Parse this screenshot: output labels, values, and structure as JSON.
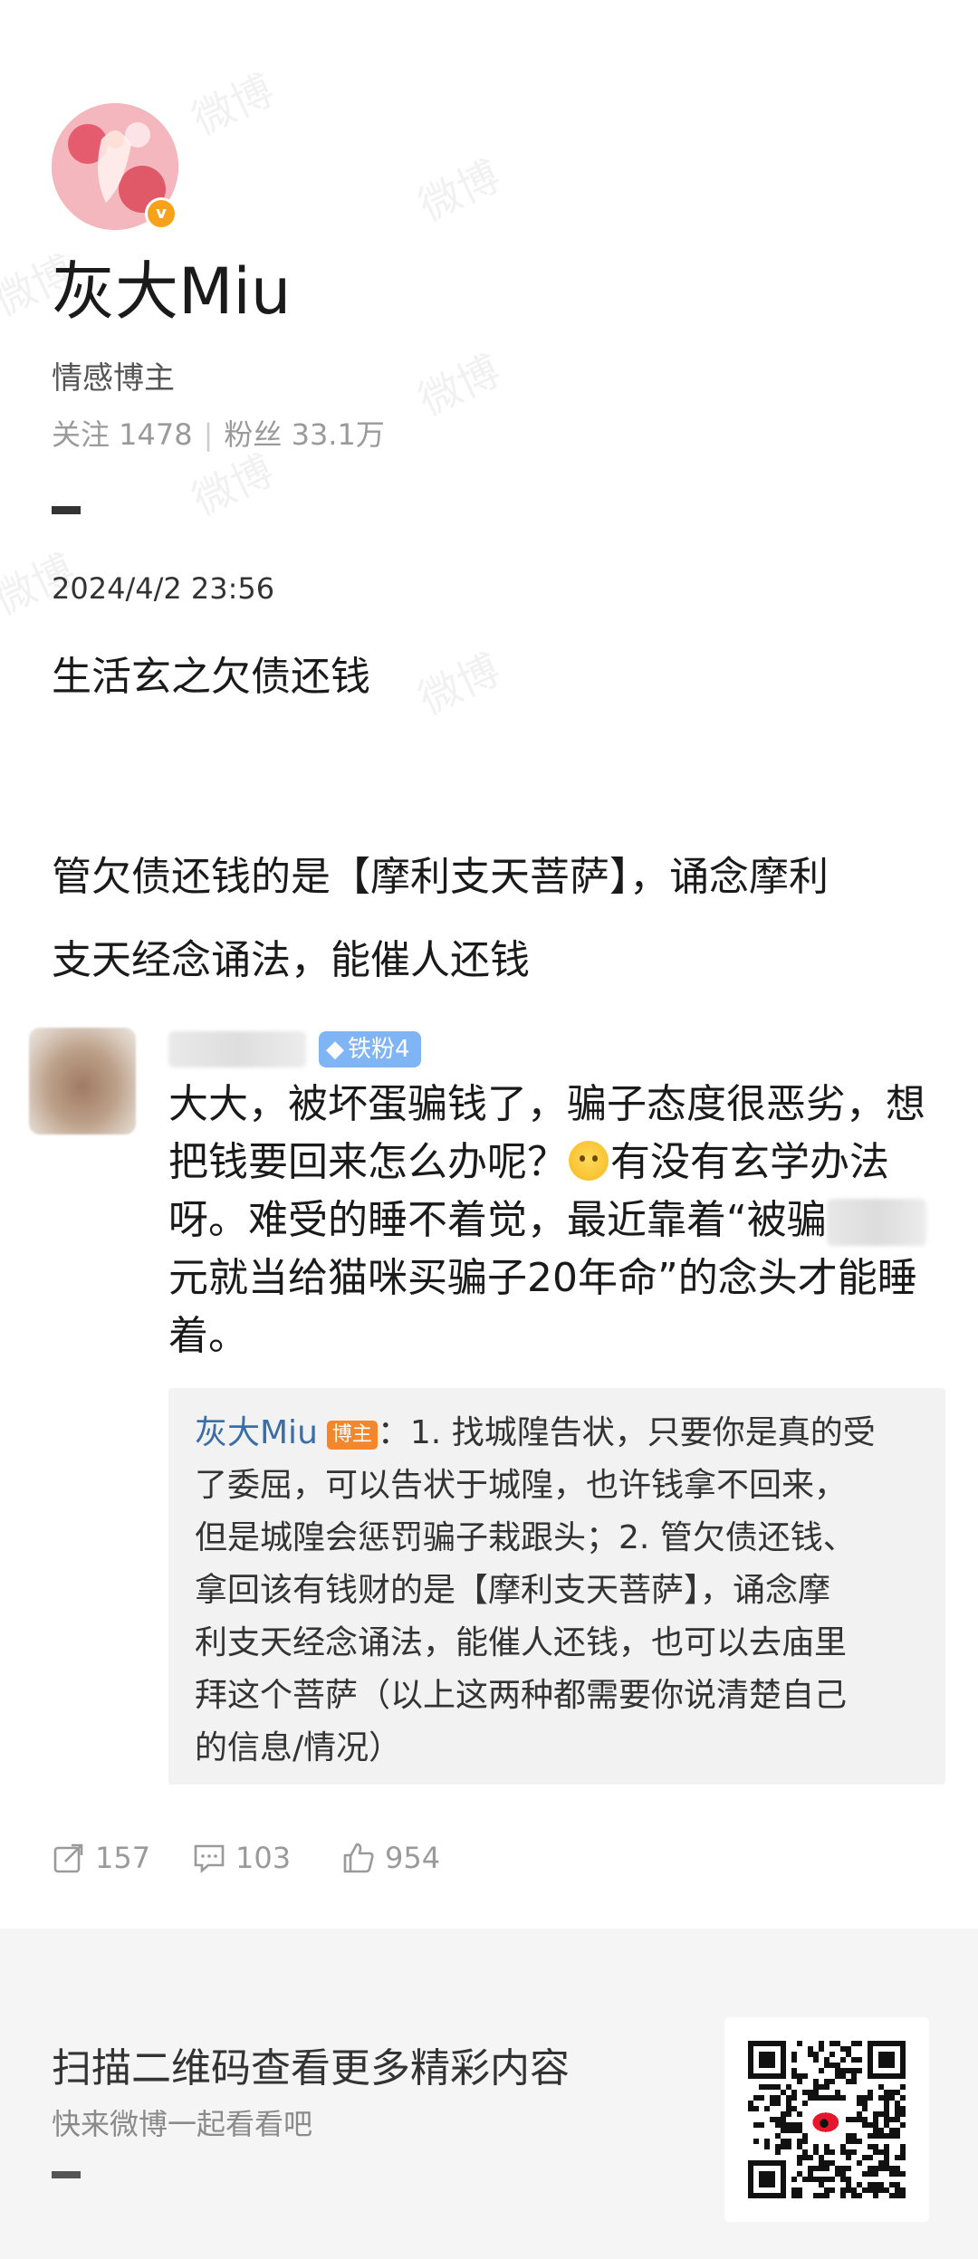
{
  "profile": {
    "name": "灰大Miu",
    "bio": "情感博主",
    "following_label": "关注 1478",
    "followers_label": "粉丝 33.1万",
    "verified_mark": "v"
  },
  "post": {
    "time": "2024/4/2 23:56",
    "title": "生活玄之欠债还钱",
    "body_line1": "管欠债还钱的是【摩利支天菩萨】，诵念摩利",
    "body_line2": "支天经念诵法，能催人还钱"
  },
  "comment": {
    "fan_badge": "铁粉4",
    "line1": "大大，被坏蛋骗钱了，骗子态度很恶劣，想",
    "line2a": "把钱要回来怎么办呢？",
    "line2b": "有没有玄学办法",
    "line3a": "呀。难受的睡不着觉，最近靠着“被骗",
    "line4": "元就当给猫咪买骗子20年命”的念头才能睡",
    "line5": "着。"
  },
  "reply": {
    "author": "灰大Miu",
    "badge": "博主",
    "line1": "：1. 找城隍告状，只要你是真的受",
    "line2": "了委屈，可以告状于城隍，也许钱拿不回来，",
    "line3": "但是城隍会惩罚骗子栽跟头；2. 管欠债还钱、",
    "line4": "拿回该有钱财的是【摩利支天菩萨】，诵念摩",
    "line5": "利支天经念诵法，能催人还钱，也可以去庙里",
    "line6": "拜这个菩萨（以上这两种都需要你说清楚自己",
    "line7": "的信息/情况）"
  },
  "actions": {
    "repost": "157",
    "comment": "103",
    "like": "954"
  },
  "footer": {
    "title": "扫描二维码查看更多精彩内容",
    "subtitle": "快来微博一起看看吧"
  },
  "watermark": "微博",
  "icons": [
    "repost-icon",
    "comment-icon",
    "like-icon",
    "verified-icon",
    "qr-code-icon",
    "emoji-icon"
  ]
}
